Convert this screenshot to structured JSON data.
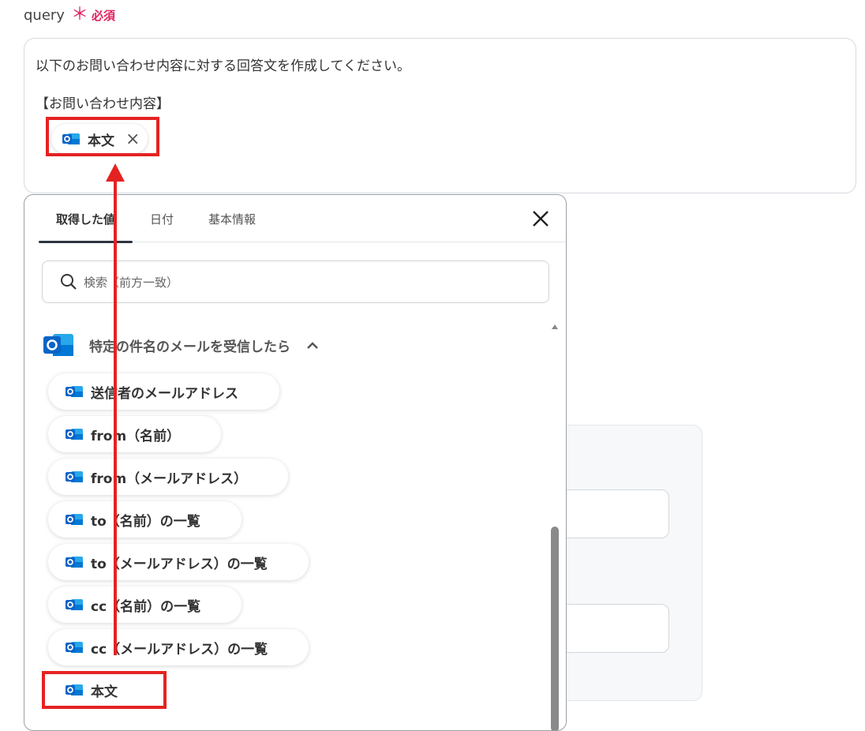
{
  "field": {
    "name": "query",
    "required_mark": "＊",
    "required_label": "必須",
    "line1": "以下のお問い合わせ内容に対する回答文を作成してください。",
    "line2": "【お問い合わせ内容】",
    "chip_label": "本文",
    "chip_remove_icon": "×"
  },
  "dropdown": {
    "tabs": [
      {
        "label": "取得した値",
        "active": true
      },
      {
        "label": "日付",
        "active": false
      },
      {
        "label": "基本情報",
        "active": false
      }
    ],
    "search_placeholder": "検索（前方一致）",
    "group_title": "特定の件名のメールを受信したら",
    "group_icon": "outlook-icon",
    "items": [
      "送信者のメールアドレス",
      "from（名前）",
      "from（メールアドレス）",
      "to（名前）の一覧",
      "to（メールアドレス）の一覧",
      "cc（名前）の一覧",
      "cc（メールアドレス）の一覧",
      "本文"
    ]
  },
  "colors": {
    "highlight": "#e52222",
    "required": "#e0245e",
    "outlook_blue": "#0a64c8"
  }
}
